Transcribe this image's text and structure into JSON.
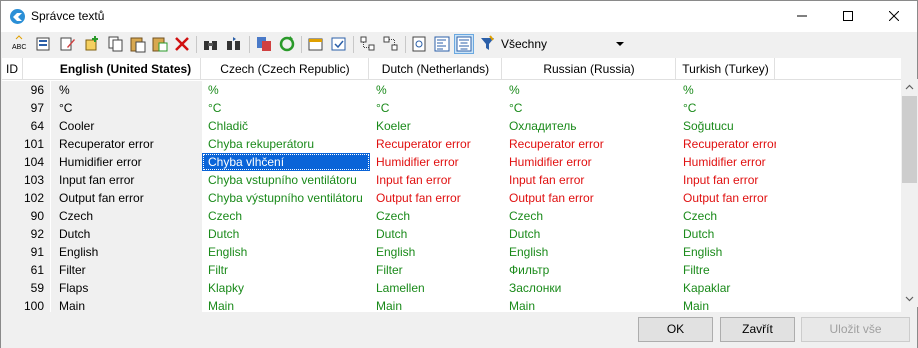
{
  "window": {
    "title": "Správce textů"
  },
  "toolbar": {
    "filter_value": "Všechny"
  },
  "grid": {
    "headers": {
      "id": "ID",
      "english": "English (United States)",
      "czech": "Czech (Czech Republic)",
      "dutch": "Dutch (Netherlands)",
      "russian": "Russian (Russia)",
      "turkish": "Turkish (Turkey)"
    },
    "rows": [
      {
        "id": "96",
        "en": "%",
        "cs": "%",
        "nl": "%",
        "ru": "%",
        "tr": "%",
        "status": "green"
      },
      {
        "id": "97",
        "en": "°C",
        "cs": "°C",
        "nl": "°C",
        "ru": "°C",
        "tr": "°C",
        "status": "green"
      },
      {
        "id": "64",
        "en": "Cooler",
        "cs": "Chladič",
        "nl": "Koeler",
        "ru": "Охладитель",
        "tr": "Soğutucu",
        "status": "green"
      },
      {
        "id": "101",
        "en": "Recuperator error",
        "cs": "Chyba rekuperátoru",
        "nl": "Recuperator error",
        "ru": "Recuperator error",
        "tr": "Recuperator error",
        "status": "red"
      },
      {
        "id": "104",
        "en": "Humidifier error",
        "cs": "Chyba vlhčení",
        "nl": "Humidifier error",
        "ru": "Humidifier error",
        "tr": "Humidifier error",
        "status": "red",
        "selected": true
      },
      {
        "id": "103",
        "en": "Input fan error",
        "cs": "Chyba vstupního ventilátoru",
        "nl": "Input fan error",
        "ru": "Input fan error",
        "tr": "Input fan error",
        "status": "red"
      },
      {
        "id": "102",
        "en": "Output fan error",
        "cs": "Chyba výstupního ventilátoru",
        "nl": "Output fan error",
        "ru": "Output fan error",
        "tr": "Output fan error",
        "status": "red"
      },
      {
        "id": "90",
        "en": "Czech",
        "cs": "Czech",
        "nl": "Czech",
        "ru": "Czech",
        "tr": "Czech",
        "status": "green"
      },
      {
        "id": "92",
        "en": "Dutch",
        "cs": "Dutch",
        "nl": "Dutch",
        "ru": "Dutch",
        "tr": "Dutch",
        "status": "green"
      },
      {
        "id": "91",
        "en": "English",
        "cs": "English",
        "nl": "English",
        "ru": "English",
        "tr": "English",
        "status": "green"
      },
      {
        "id": "61",
        "en": "Filter",
        "cs": "Filtr",
        "nl": "Filter",
        "ru": "Фильтр",
        "tr": "Filtre",
        "status": "green"
      },
      {
        "id": "59",
        "en": "Flaps",
        "cs": "Klapky",
        "nl": "Lamellen",
        "ru": "Заслонки",
        "tr": "Kapaklar",
        "status": "green"
      },
      {
        "id": "100",
        "en": "Main",
        "cs": "Main",
        "nl": "Main",
        "ru": "Main",
        "tr": "Main",
        "status": "green"
      }
    ]
  },
  "buttons": {
    "ok": "OK",
    "close": "Zavřít",
    "save_all": "Uložit vše"
  },
  "colors": {
    "translated": "#1a8a1a",
    "untranslated": "#e01010",
    "selection": "#0a64d8"
  }
}
